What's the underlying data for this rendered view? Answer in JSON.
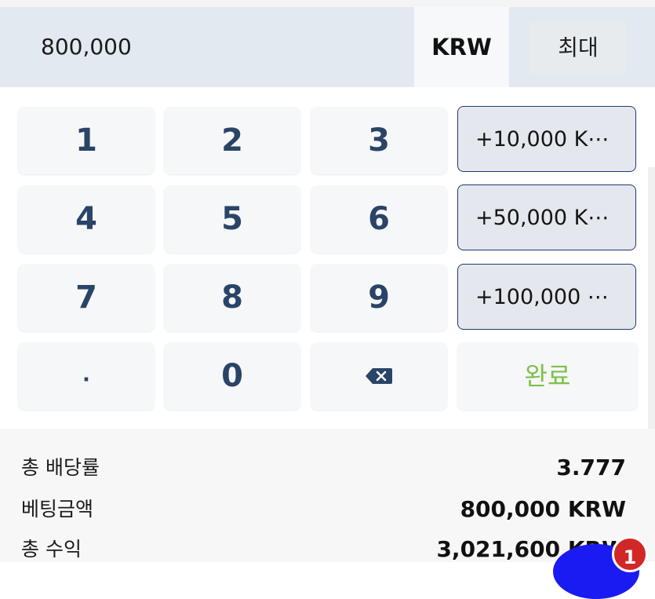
{
  "amount": {
    "value": "800,000",
    "currency": "KRW",
    "max_label": "최대"
  },
  "keypad": {
    "keys": [
      "1",
      "2",
      "3",
      "4",
      "5",
      "6",
      "7",
      "8",
      "9",
      "·",
      "0"
    ],
    "quick_add": [
      "+10,000 K⋯",
      "+50,000 K⋯",
      "+100,000 ⋯"
    ],
    "backspace_icon": "backspace-icon",
    "done_label": "완료"
  },
  "summary": {
    "rows": [
      {
        "label": "총 배당률",
        "value": "3.777"
      },
      {
        "label": "베팅금액",
        "value": "800,000 KRW"
      },
      {
        "label": "총 수익",
        "value": "3,021,600 KRW"
      }
    ]
  },
  "notification": {
    "count": "1"
  },
  "colors": {
    "accent_navy": "#2a4468",
    "done_green": "#7cc24b",
    "badge_red": "#d22727",
    "fab_blue": "#1a1af2"
  }
}
